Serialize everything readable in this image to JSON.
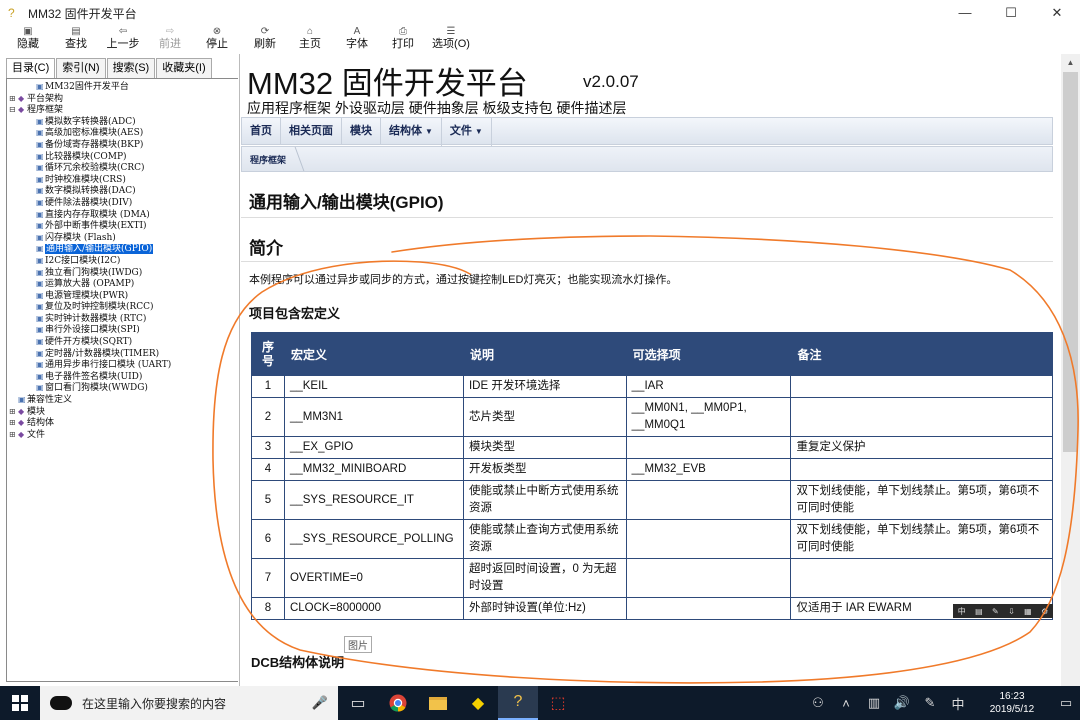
{
  "window": {
    "title": "MM32 固件开发平台",
    "controls": [
      "—",
      "☐",
      "✕"
    ]
  },
  "toolbar": [
    {
      "icon": "hide-icon",
      "label": "隐藏",
      "enabled": true
    },
    {
      "icon": "find-icon",
      "label": "查找",
      "enabled": true
    },
    {
      "icon": "back-icon",
      "label": "上一步",
      "enabled": true
    },
    {
      "icon": "forward-icon",
      "label": "前进",
      "enabled": false
    },
    {
      "icon": "stop-icon",
      "label": "停止",
      "enabled": true
    },
    {
      "icon": "refresh-icon",
      "label": "刷新",
      "enabled": true
    },
    {
      "icon": "home-icon",
      "label": "主页",
      "enabled": true
    },
    {
      "icon": "font-icon",
      "label": "字体",
      "enabled": true
    },
    {
      "icon": "print-icon",
      "label": "打印",
      "enabled": true
    },
    {
      "icon": "options-icon",
      "label": "选项(O)",
      "enabled": true
    }
  ],
  "left_tabs": [
    "目录(C)",
    "索引(N)",
    "搜索(S)",
    "收藏夹(I)"
  ],
  "tree": [
    {
      "pm": "",
      "ico": "doc",
      "label": "MM32固件开发平台",
      "level": 1
    },
    {
      "pm": "+",
      "ico": "book",
      "label": "平台架构",
      "level": 0
    },
    {
      "pm": "-",
      "ico": "book",
      "label": "程序框架",
      "level": 0
    },
    {
      "pm": "",
      "ico": "doc",
      "label": "模拟数字转换器(ADC)",
      "level": 1
    },
    {
      "pm": "",
      "ico": "doc",
      "label": "高级加密标准模块(AES)",
      "level": 1
    },
    {
      "pm": "",
      "ico": "doc",
      "label": "备份域寄存器模块(BKP)",
      "level": 1
    },
    {
      "pm": "",
      "ico": "doc",
      "label": "比较器模块(COMP)",
      "level": 1
    },
    {
      "pm": "",
      "ico": "doc",
      "label": "循环冗余校验模块(CRC)",
      "level": 1
    },
    {
      "pm": "",
      "ico": "doc",
      "label": "时钟校准模块(CRS)",
      "level": 1
    },
    {
      "pm": "",
      "ico": "doc",
      "label": "数字模拟转换器(DAC)",
      "level": 1
    },
    {
      "pm": "",
      "ico": "doc",
      "label": "硬件除法器模块(DIV)",
      "level": 1
    },
    {
      "pm": "",
      "ico": "doc",
      "label": "直接内存存取模块 (DMA)",
      "level": 1
    },
    {
      "pm": "",
      "ico": "doc",
      "label": "外部中断事件模块(EXTI)",
      "level": 1
    },
    {
      "pm": "",
      "ico": "doc",
      "label": "闪存模块 (Flash)",
      "level": 1
    },
    {
      "pm": "",
      "ico": "doc",
      "label": "通用输入/输出模块(GPIO)",
      "level": 1,
      "selected": true
    },
    {
      "pm": "",
      "ico": "doc",
      "label": "I2C接口模块(I2C)",
      "level": 1
    },
    {
      "pm": "",
      "ico": "doc",
      "label": "独立看门狗模块(IWDG)",
      "level": 1
    },
    {
      "pm": "",
      "ico": "doc",
      "label": "运算放大器 (OPAMP)",
      "level": 1
    },
    {
      "pm": "",
      "ico": "doc",
      "label": "电源管理模块(PWR)",
      "level": 1
    },
    {
      "pm": "",
      "ico": "doc",
      "label": "复位及时钟控制模块(RCC)",
      "level": 1
    },
    {
      "pm": "",
      "ico": "doc",
      "label": "实时钟计数器模块 (RTC)",
      "level": 1
    },
    {
      "pm": "",
      "ico": "doc",
      "label": "串行外设接口模块(SPI)",
      "level": 1
    },
    {
      "pm": "",
      "ico": "doc",
      "label": "硬件开方模块(SQRT)",
      "level": 1
    },
    {
      "pm": "",
      "ico": "doc",
      "label": "定时器/计数器模块(TIMER)",
      "level": 1
    },
    {
      "pm": "",
      "ico": "doc",
      "label": "通用异步串行接口模块 (UART)",
      "level": 1
    },
    {
      "pm": "",
      "ico": "doc",
      "label": "电子器件签名模块(UID)",
      "level": 1
    },
    {
      "pm": "",
      "ico": "doc",
      "label": "窗口看门狗模块(WWDG)",
      "level": 1
    },
    {
      "pm": "",
      "ico": "doc",
      "label": "兼容性定义",
      "level": 0
    },
    {
      "pm": "+",
      "ico": "book",
      "label": "模块",
      "level": 0
    },
    {
      "pm": "+",
      "ico": "book",
      "label": "结构体",
      "level": 0
    },
    {
      "pm": "+",
      "ico": "book",
      "label": "文件",
      "level": 0
    }
  ],
  "page": {
    "title": "MM32 固件开发平台",
    "version": "v2.0.07",
    "subtitle": "应用程序框架 外设驱动层 硬件抽象层 板级支持包 硬件描述层",
    "nav": [
      {
        "label": "首页",
        "dropdown": false
      },
      {
        "label": "相关页面",
        "dropdown": false
      },
      {
        "label": "模块",
        "dropdown": false
      },
      {
        "label": "结构体",
        "dropdown": true
      },
      {
        "label": "文件",
        "dropdown": true
      }
    ],
    "breadcrumb": "程序框架",
    "module_title": "通用输入/输出模块(GPIO)",
    "intro_heading": "简介",
    "intro_text": "本例程序可以通过异步或同步的方式，通过按键控制LED灯亮灭；也能实现流水灯操作。",
    "macro_heading": "项目包含宏定义",
    "table": {
      "headers": [
        "序号",
        "宏定义",
        "说明",
        "可选择项",
        "备注"
      ],
      "rows": [
        [
          "1",
          "__KEIL",
          "IDE 开发环境选择",
          "__IAR",
          ""
        ],
        [
          "2",
          "__MM3N1",
          "芯片类型",
          "__MM0N1, __MM0P1, __MM0Q1",
          ""
        ],
        [
          "3",
          "__EX_GPIO",
          "模块类型",
          "",
          "重复定义保护"
        ],
        [
          "4",
          "__MM32_MINIBOARD",
          "开发板类型",
          "__MM32_EVB",
          ""
        ],
        [
          "5",
          "__SYS_RESOURCE_IT",
          "使能或禁止中断方式使用系统资源",
          "",
          "双下划线使能，单下划线禁止。第5项，第6项不可同时使能"
        ],
        [
          "6",
          "__SYS_RESOURCE_POLLING",
          "使能或禁止查询方式使用系统资源",
          "",
          "双下划线使能，单下划线禁止。第5项，第6项不可同时使能"
        ],
        [
          "7",
          "OVERTIME=0",
          "超时返回时间设置，0 为无超时设置",
          "",
          ""
        ],
        [
          "8",
          "CLOCK=8000000",
          "外部时钟设置(单位:Hz)",
          "",
          "仅适用于 IAR EWARM"
        ]
      ]
    },
    "image_tooltip": "图片",
    "next_heading": "DCB结构体说明"
  },
  "taskbar": {
    "search_placeholder": "在这里输入你要搜索的内容",
    "apps": [
      "task-view-icon",
      "chrome-icon",
      "file-explorer-icon",
      "app-icon",
      "help-app-icon",
      "pdf-icon"
    ],
    "time": "16:23",
    "date": "2019/5/12"
  },
  "colors": {
    "table_header": "#2e4a7a",
    "selection": "#0a64d8",
    "annotation": "#f07a2a",
    "taskbar": "#0d1a2a"
  }
}
